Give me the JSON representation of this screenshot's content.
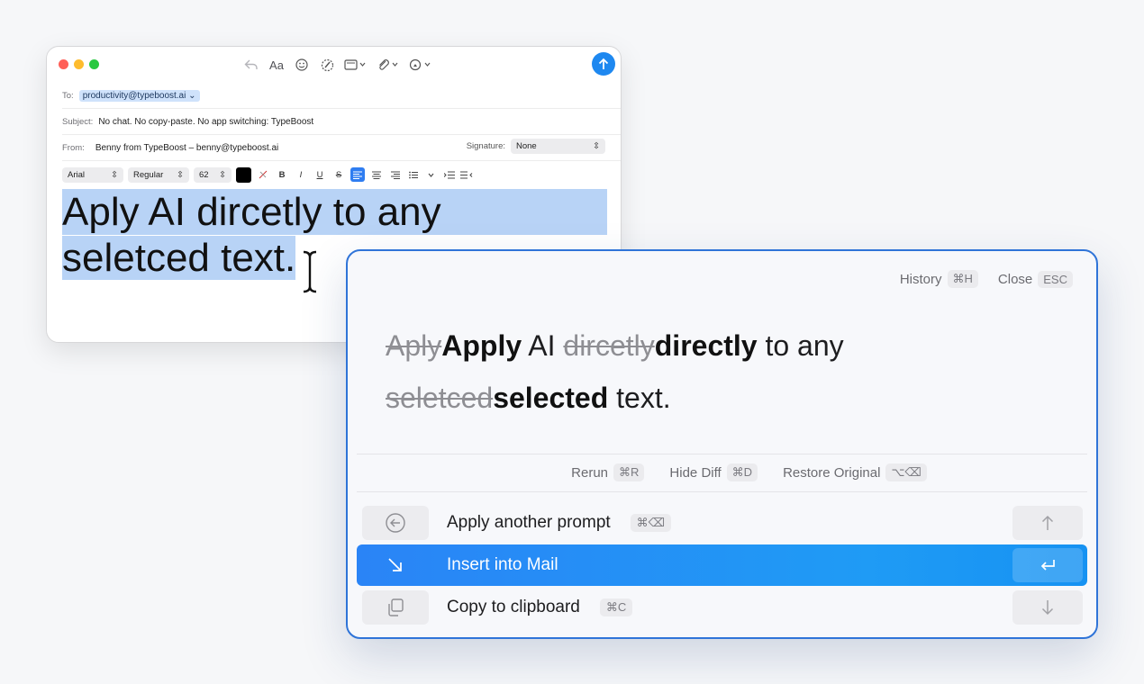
{
  "mail": {
    "to_label": "To:",
    "to_value": "productivity@typeboost.ai",
    "subject_label": "Subject:",
    "subject_value": "No chat. No copy-paste. No app switching: TypeBoost",
    "from_label": "From:",
    "from_value": "Benny from TypeBoost – benny@typeboost.ai",
    "signature_label": "Signature:",
    "signature_value": "None",
    "toolbar": {
      "font_button": "Aa"
    },
    "format": {
      "font": "Arial",
      "style": "Regular",
      "size": "62",
      "bold": "B",
      "italic": "I",
      "underline": "U",
      "strike": "S"
    },
    "body_line1": "Aply AI dircetly to any",
    "body_line2": "seletced text."
  },
  "panel": {
    "history_label": "History",
    "history_kbd": "⌘H",
    "close_label": "Close",
    "close_kbd": "ESC",
    "diff": {
      "del1": "Aply",
      "ins1": "Apply",
      "t1": " AI ",
      "del2": "dircetly",
      "ins2": "directly",
      "t2": " to any",
      "del3": "seletced",
      "ins3": "selected",
      "t3": " text."
    },
    "rerun_label": "Rerun",
    "rerun_kbd": "⌘R",
    "hidediff_label": "Hide Diff",
    "hidediff_kbd": "⌘D",
    "restore_label": "Restore Original",
    "restore_kbd": "⌥⌫",
    "options": [
      {
        "label": "Apply another prompt",
        "kbd": "⌘⌫"
      },
      {
        "label": "Insert into Mail"
      },
      {
        "label": "Copy to clipboard",
        "kbd": "⌘C"
      }
    ]
  },
  "colors": {
    "accent": "#1e88f0",
    "highlight": "#b8d3f6",
    "panel_border": "#2f74d8"
  }
}
